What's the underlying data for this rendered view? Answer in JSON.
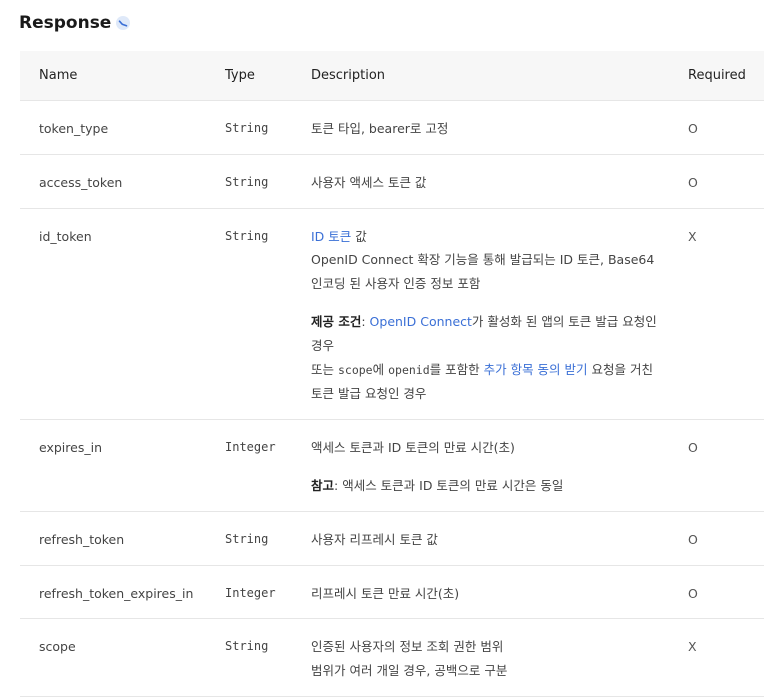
{
  "heading": "Response",
  "headers": {
    "name": "Name",
    "type": "Type",
    "description": "Description",
    "required": "Required"
  },
  "rows": [
    {
      "name": "token_type",
      "type": "String",
      "desc": "토큰 타입, bearer로 고정",
      "required": "O"
    },
    {
      "name": "access_token",
      "type": "String",
      "desc": "사용자 액세스 토큰 값",
      "required": "O"
    },
    {
      "name": "id_token",
      "type": "String",
      "required": "X",
      "desc_link": "ID 토큰",
      "desc_after_link": " 값",
      "desc_line2": "OpenID Connect 확장 기능을 통해 발급되는 ID 토큰, Base64",
      "desc_line3": "인코딩 된 사용자 인증 정보 포함",
      "cond_label": "제공 조건",
      "cond_sep": ": ",
      "cond_link": "OpenID Connect",
      "cond_rest": "가 활성화 된 앱의 토큰 발급 요청인",
      "cond_line2": "경우",
      "cond_line3_pre": "또는 ",
      "cond_line3_code1": "scope",
      "cond_line3_mid1": "에 ",
      "cond_line3_code2": "openid",
      "cond_line3_mid2": "를 포함한 ",
      "cond_line3_link": "추가 항목 동의 받기",
      "cond_line3_post": " 요청을 거친",
      "cond_line4": "토큰 발급 요청인 경우"
    },
    {
      "name": "expires_in",
      "type": "Integer",
      "required": "O",
      "desc": "액세스 토큰과 ID 토큰의 만료 시간(초)",
      "note_label": "참고",
      "note_text": ": 액세스 토큰과 ID 토큰의 만료 시간은 동일"
    },
    {
      "name": "refresh_token",
      "type": "String",
      "desc": "사용자 리프레시 토큰 값",
      "required": "O"
    },
    {
      "name": "refresh_token_expires_in",
      "type": "Integer",
      "desc": "리프레시 토큰 만료 시간(초)",
      "required": "O"
    },
    {
      "name": "scope",
      "type": "String",
      "required": "X",
      "desc": "인증된 사용자의 정보 조회 권한 범위",
      "desc_line2": "범위가 여러 개일 경우, 공백으로 구분"
    }
  ],
  "colors": {
    "link": "#3a6fd6",
    "header_bg": "#f7f7f7",
    "border": "#e6e6e6"
  },
  "icons": {
    "heading": "link-icon"
  }
}
